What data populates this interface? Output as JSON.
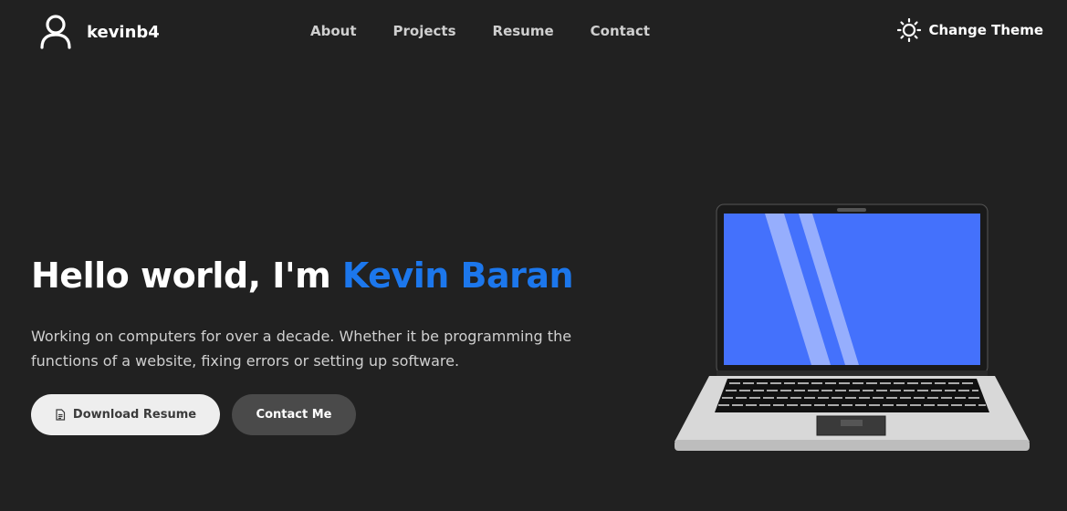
{
  "brand": {
    "name": "kevinb4",
    "icon": "user-icon"
  },
  "nav": {
    "links": [
      {
        "label": "About"
      },
      {
        "label": "Projects"
      },
      {
        "label": "Resume"
      },
      {
        "label": "Contact"
      }
    ],
    "theme_button": {
      "label": "Change Theme",
      "icon": "sun-icon"
    }
  },
  "hero": {
    "title_prefix": "Hello world, I'm ",
    "title_name": "Kevin Baran",
    "description": "Working on computers for over a decade. Whether it be programming the functions of a website, fixing errors or setting up software.",
    "download_button": {
      "label": "Download Resume",
      "icon": "document-icon"
    },
    "contact_button": {
      "label": "Contact Me"
    }
  },
  "colors": {
    "background": "#212121",
    "accent": "#1c77ec",
    "screen": "#4471fc"
  }
}
